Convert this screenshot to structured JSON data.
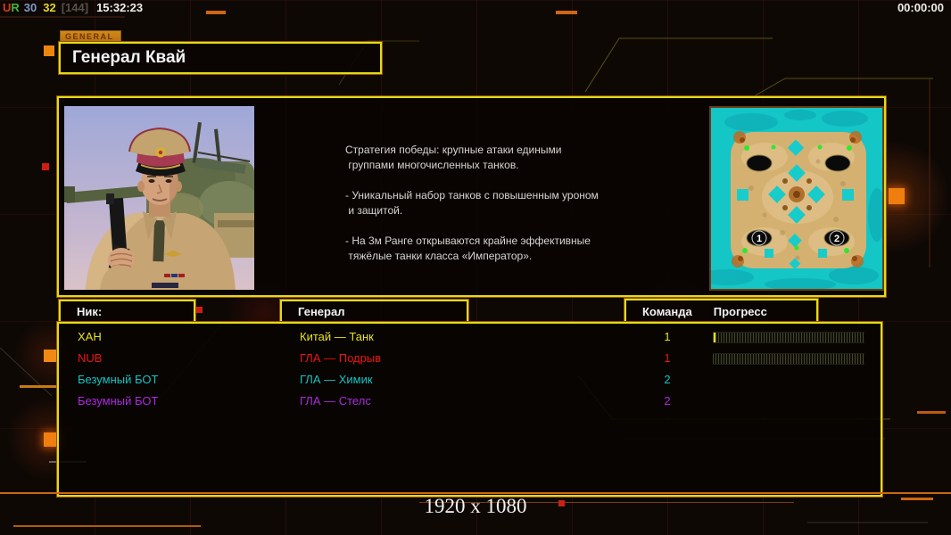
{
  "hud": {
    "perf": {
      "ur": "UR",
      "fps": "30",
      "ms": "32",
      "cap": "[144]",
      "clock": "15:32:23"
    },
    "timer": "00:00:00"
  },
  "header": {
    "tab": "GENERAL",
    "title": "Генерал Квай"
  },
  "briefing": {
    "description": "Стратегия победы: крупные атаки едиными\n группами многочисленных танков.\n\n- Уникальный набор танков с повышенным уроном\n и защитой.\n\n- На 3м Ранге открываются крайне эффективные\n тяжёлые танки класса «Император».",
    "map": {
      "markers": [
        "1",
        "2"
      ]
    }
  },
  "lobby": {
    "headers": {
      "nick": "Ник:",
      "general": "Генерал",
      "team": "Команда",
      "progress": "Прогресс"
    },
    "rows": [
      {
        "nick": "ХАН",
        "general": "Китай — Танк",
        "team": "1",
        "color": "#ece31a",
        "has_progress": true,
        "has_cursor": true
      },
      {
        "nick": "NUB",
        "general": "ГЛА — Подрыв",
        "team": "1",
        "color": "#ee1414",
        "has_progress": true,
        "has_cursor": false
      },
      {
        "nick": "Безумный БОТ",
        "general": "ГЛА — Химик",
        "team": "2",
        "color": "#17c3c3",
        "has_progress": false,
        "has_cursor": false
      },
      {
        "nick": "Безумный БОТ",
        "general": "ГЛА — Стелс",
        "team": "2",
        "color": "#ae2be0",
        "has_progress": false,
        "has_cursor": false
      }
    ]
  },
  "footer": {
    "resolution": "1920 x 1080"
  },
  "colors": {
    "frame_yellow": "#e3dc12",
    "frame_orange": "#96520e",
    "accent_orange": "#ee8410",
    "hud_ur": "#d83818",
    "hud_ur2": "#38b838",
    "hud_fps": "#8098c8",
    "hud_ms": "#e8d820",
    "hud_cap": "#585048"
  }
}
